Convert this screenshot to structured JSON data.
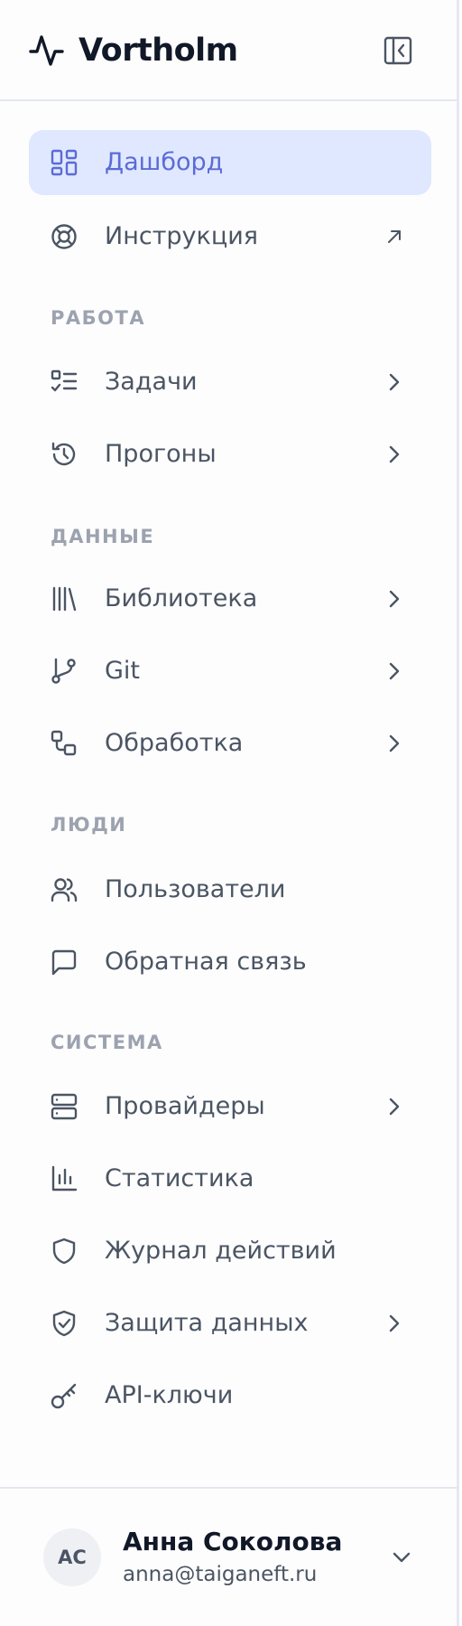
{
  "app": {
    "title": "Vortholm"
  },
  "nav": {
    "dashboard": "Дашборд",
    "guide": "Инструкция",
    "sections": {
      "work": "РАБОТА",
      "data": "ДАННЫЕ",
      "people": "ЛЮДИ",
      "system": "СИСТЕМА"
    },
    "items": {
      "tasks": "Задачи",
      "runs": "Прогоны",
      "library": "Библиотека",
      "git": "Git",
      "processing": "Обработка",
      "users": "Пользователи",
      "feedback": "Обратная связь",
      "providers": "Провайдеры",
      "statistics": "Статистика",
      "audit_log": "Журнал действий",
      "data_protection": "Защита данных",
      "api_keys": "API-ключи"
    }
  },
  "user": {
    "initials": "АС",
    "name": "Анна Соколова",
    "email": "anna@taiganeft.ru"
  },
  "colors": {
    "accent": "#5b6bd6",
    "active_bg": "#e0e8ff",
    "text": "#4b5563",
    "muted": "#9ca3af",
    "heading": "#111827"
  },
  "icons": {
    "logo": "activity-pulse-icon",
    "collapse": "sidebar-collapse-icon",
    "dashboard": "dashboard-grid-icon",
    "guide": "lifebuoy-icon",
    "external": "external-arrow-icon",
    "tasks": "task-list-icon",
    "runs": "history-icon",
    "library": "library-icon",
    "git": "git-branch-icon",
    "processing": "workflow-icon",
    "users": "users-icon",
    "feedback": "message-square-icon",
    "providers": "server-icon",
    "statistics": "bar-chart-icon",
    "audit_log": "shield-icon",
    "data_protection": "shield-check-icon",
    "api_keys": "key-icon",
    "chevron": "chevron-right-icon",
    "user_menu": "chevron-down-icon"
  }
}
